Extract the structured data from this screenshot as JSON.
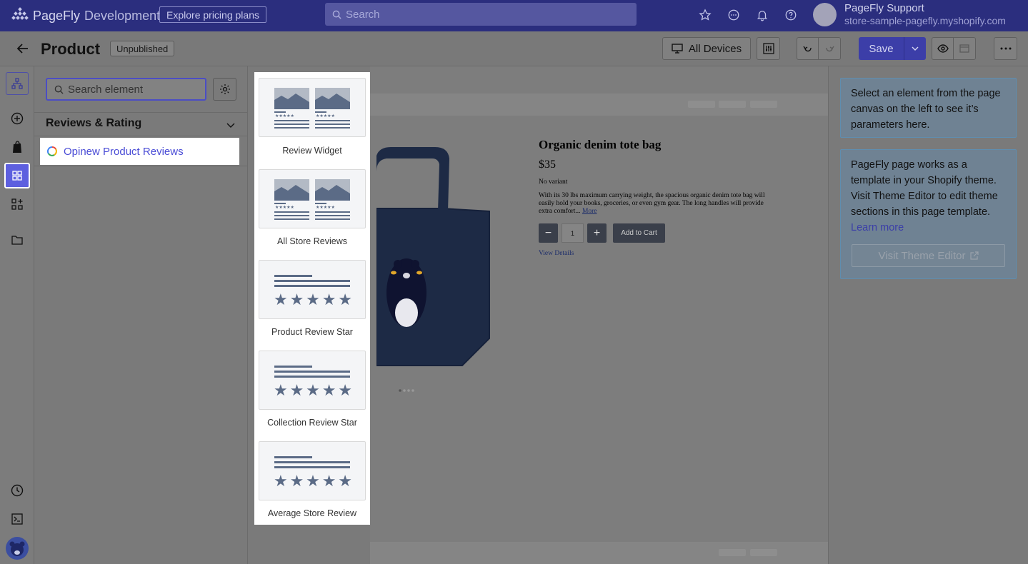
{
  "topbar": {
    "brand": "PageFly",
    "environment": "Development",
    "pricing_label": "Explore pricing plans",
    "search_placeholder": "Search",
    "user_name": "PageFly Support",
    "user_store": "store-sample-pagefly.myshopify.com"
  },
  "header": {
    "title": "Product",
    "status_badge": "Unpublished",
    "devices_label": "All Devices",
    "save_label": "Save"
  },
  "element_panel": {
    "search_placeholder": "Search element",
    "section_title": "Reviews & Rating",
    "items": [
      {
        "label": "Opinew Product Reviews"
      }
    ]
  },
  "widgets": [
    {
      "label": "Review Widget",
      "icon": "review-widget-icon"
    },
    {
      "label": "All Store Reviews",
      "icon": "review-widget-icon"
    },
    {
      "label": "Product Review Star",
      "icon": "review-star-icon"
    },
    {
      "label": "Collection Review Star",
      "icon": "review-star-icon"
    },
    {
      "label": "Average Store Review",
      "icon": "review-star-icon"
    }
  ],
  "canvas": {
    "product_title": "Organic denim tote bag",
    "price": "$35",
    "variant": "No variant",
    "description": "With its 30 lbs maximum carrying weight, the spacious organic denim tote bag will easily hold your books, groceries, or even gym gear. The long handles will provide extra comfort...",
    "more_label": "More",
    "quantity": "1",
    "add_to_cart": "Add to Cart",
    "view_details": "View Details"
  },
  "right_panel": {
    "info_text": "Select an element from the page canvas on the left to see it’s parameters here.",
    "template_text": "PageFly page works as a template in your Shopify theme. Visit Theme Editor to edit theme sections in this page template.",
    "learn_more": "Learn more",
    "visit_label": "Visit Theme Editor"
  },
  "colors": {
    "topbar": "#2b2e7e",
    "accent": "#5d5fdf",
    "save": "#3c3ea8",
    "overlay": "#7a7a7a"
  }
}
